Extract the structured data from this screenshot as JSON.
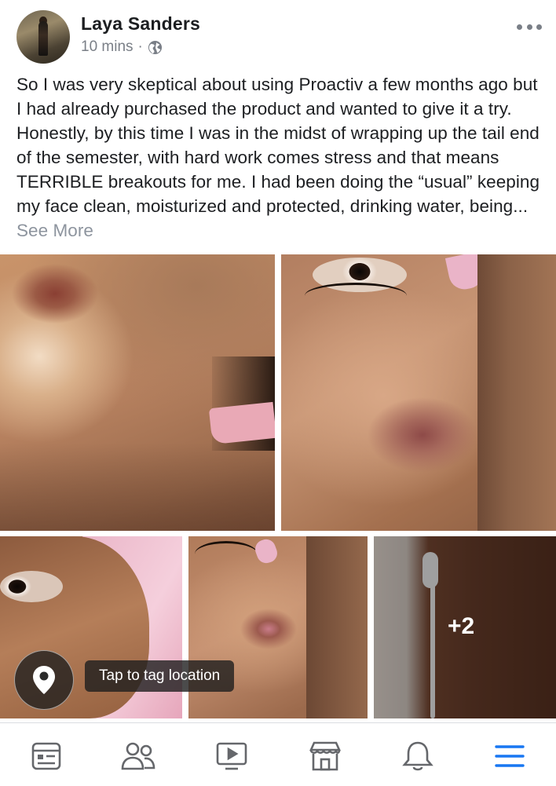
{
  "post": {
    "author": "Laya Sanders",
    "time": "10 mins",
    "separator": "·",
    "text": "So I was very skeptical about using Proactiv a few months ago but I had already purchased the product and wanted to give it a try. Honestly, by this time I was in the midst of wrapping up the tail end of the semester, with hard work comes stress and that means TERRIBLE breakouts for me. I had been doing the “usual” keeping my face clean, moisturized and protected, drinking water, being...",
    "see_more": "See More",
    "photos_overflow": "+2"
  },
  "location": {
    "tooltip": "Tap to tag location"
  },
  "icons": {
    "privacy": "globe-icon",
    "menu": "more-options-icon",
    "location": "map-pin-icon"
  },
  "nav": {
    "items": [
      "news-feed-icon",
      "friends-icon",
      "watch-icon",
      "marketplace-icon",
      "notifications-icon",
      "menu-icon"
    ],
    "active_color": "#1877f2",
    "inactive_color": "#65676b"
  }
}
